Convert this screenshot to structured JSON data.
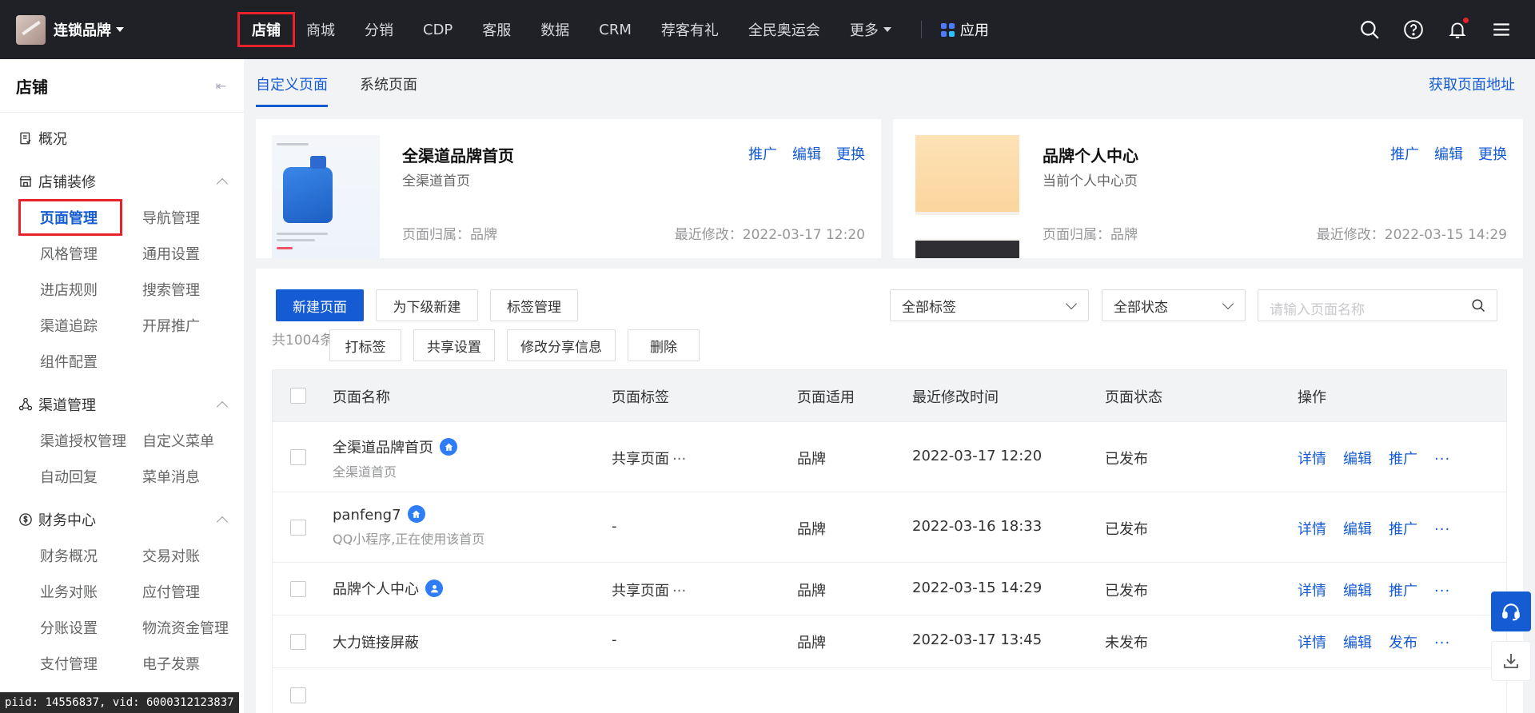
{
  "topbar": {
    "brand": "连锁品牌",
    "nav": [
      "店铺",
      "商城",
      "分销",
      "CDP",
      "客服",
      "数据",
      "CRM",
      "荐客有礼",
      "全民奥运会",
      "更多"
    ],
    "apps_label": "应用"
  },
  "sidebar": {
    "title": "店铺",
    "overview": "概况",
    "groups": [
      {
        "title": "店铺装修",
        "items": [
          "页面管理",
          "导航管理",
          "风格管理",
          "通用设置",
          "进店规则",
          "搜索管理",
          "渠道追踪",
          "开屏推广",
          "组件配置"
        ]
      },
      {
        "title": "渠道管理",
        "items": [
          "渠道授权管理",
          "自定义菜单",
          "自动回复",
          "菜单消息"
        ]
      },
      {
        "title": "财务中心",
        "items": [
          "财务概况",
          "交易对账",
          "业务对账",
          "应付管理",
          "分账设置",
          "物流资金管理",
          "支付管理",
          "电子发票"
        ]
      }
    ]
  },
  "tabs": [
    "自定义页面",
    "系统页面"
  ],
  "get_url": "获取页面地址",
  "cards": [
    {
      "title": "全渠道品牌首页",
      "sub": "全渠道首页",
      "owner": "页面归属：品牌",
      "modified": "最近修改：2022-03-17 12:20",
      "actions": [
        "推广",
        "编辑",
        "更换"
      ]
    },
    {
      "title": "品牌个人中心",
      "sub": "当前个人中心页",
      "owner": "页面归属：品牌",
      "modified": "最近修改：2022-03-15 14:29",
      "actions": [
        "推广",
        "编辑",
        "更换"
      ]
    }
  ],
  "toolbar": {
    "new_page": "新建页面",
    "sub_new": "为下级新建",
    "tag_manage": "标签管理",
    "tag_select": "全部标签",
    "status_select": "全部状态",
    "search_placeholder": "请输入页面名称"
  },
  "batch": {
    "count": "共1004条",
    "actions": [
      "打标签",
      "共享设置",
      "修改分享信息",
      "删除"
    ]
  },
  "table": {
    "headers": [
      "页面名称",
      "页面标签",
      "页面适用",
      "最近修改时间",
      "页面状态",
      "操作"
    ],
    "rows": [
      {
        "name": "全渠道品牌首页",
        "sub": "全渠道首页",
        "badge": "home",
        "tag": "共享页面",
        "tag_more": "···",
        "scope": "品牌",
        "time": "2022-03-17 12:20",
        "status": "已发布",
        "actions": [
          "详情",
          "编辑",
          "推广"
        ],
        "more": "···"
      },
      {
        "name": "panfeng7",
        "sub": "QQ小程序,正在使用该首页",
        "badge": "home",
        "tag": "-",
        "tag_more": "",
        "scope": "品牌",
        "time": "2022-03-16 18:33",
        "status": "已发布",
        "actions": [
          "详情",
          "编辑",
          "推广"
        ],
        "more": "···"
      },
      {
        "name": "品牌个人中心",
        "sub": "",
        "badge": "user",
        "tag": "共享页面",
        "tag_more": "···",
        "scope": "品牌",
        "time": "2022-03-15 14:29",
        "status": "已发布",
        "actions": [
          "详情",
          "编辑",
          "推广"
        ],
        "more": "···"
      },
      {
        "name": "大力链接屏蔽",
        "sub": "",
        "badge": "",
        "tag": "-",
        "tag_more": "",
        "scope": "品牌",
        "time": "2022-03-17 13:45",
        "status": "未发布",
        "actions": [
          "详情",
          "编辑",
          "发布"
        ],
        "more": "···"
      }
    ]
  },
  "footer_tip": "piid: 14556837, vid: 6000312123837"
}
